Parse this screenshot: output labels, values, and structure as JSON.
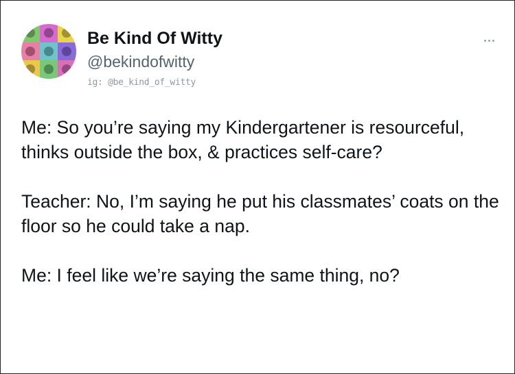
{
  "tweet": {
    "author": {
      "display_name": "Be Kind Of Witty",
      "handle": "@bekindofwitty",
      "instagram": "ig: @be_kind_of_witty",
      "avatar_icon": "pop-art-grid-avatar"
    },
    "more_icon": "more-options-icon",
    "paragraphs": [
      "Me: So you’re saying my Kindergartener is resourceful, thinks outside the box, & practices self-care?",
      "Teacher: No, I’m saying he put his classmates’ coats on the floor so he could take a nap.",
      "Me: I feel like we’re saying the same thing, no?"
    ]
  }
}
